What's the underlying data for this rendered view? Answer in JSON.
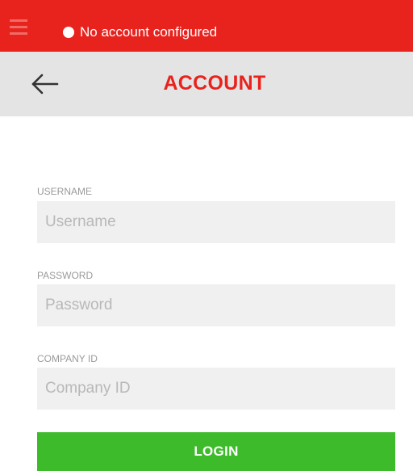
{
  "status_bar": {
    "text": "No account configured",
    "menu_icon": "hamburger-menu-icon",
    "status_icon": "status-dot-icon",
    "background": "#e8231e"
  },
  "header": {
    "title": "ACCOUNT",
    "back_icon": "back-arrow-icon",
    "title_color": "#e8231e"
  },
  "form": {
    "username": {
      "label": "USERNAME",
      "placeholder": "Username",
      "value": ""
    },
    "password": {
      "label": "PASSWORD",
      "placeholder": "Password",
      "value": ""
    },
    "company_id": {
      "label": "COMPANY ID",
      "placeholder": "Company ID",
      "value": ""
    },
    "login_label": "LOGIN",
    "login_color": "#3dbb2a"
  }
}
